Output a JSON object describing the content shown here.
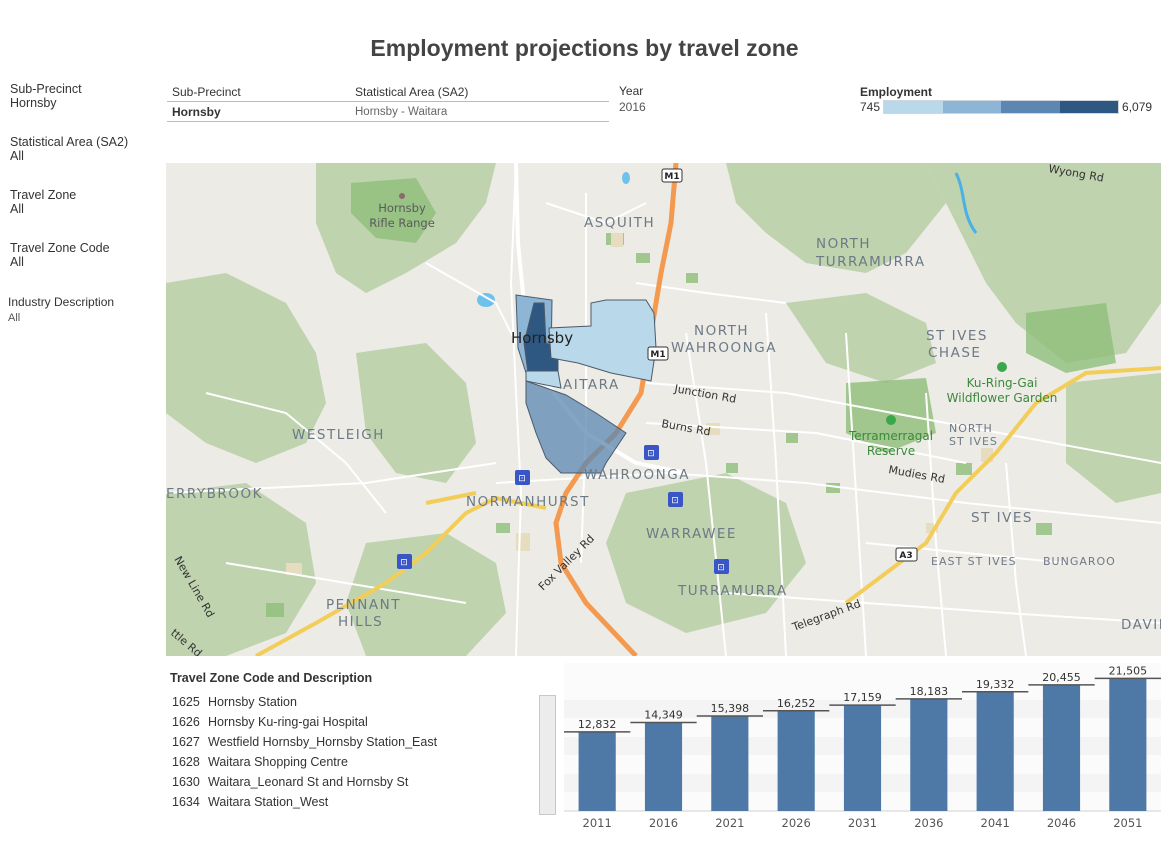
{
  "title": "Employment projections by travel zone",
  "filters": [
    {
      "label": "Sub-Precinct",
      "value": "Hornsby"
    },
    {
      "label": "Statistical Area (SA2)",
      "value": "All"
    },
    {
      "label": "Travel Zone",
      "value": "All"
    },
    {
      "label": "Travel Zone Code",
      "value": "All"
    },
    {
      "label": "Industry Description",
      "value": "All"
    }
  ],
  "info_table": {
    "headers": [
      "Sub-Precinct",
      "Statistical Area (SA2)"
    ],
    "row": [
      "Hornsby",
      "Hornsby - Waitara"
    ]
  },
  "year": {
    "label": "Year",
    "value": "2016"
  },
  "legend": {
    "title": "Employment",
    "min": "745",
    "max": "6,079",
    "colors": [
      "#b9d8ea",
      "#8db5d6",
      "#5c87b2",
      "#2e5882"
    ]
  },
  "map": {
    "places": [
      {
        "name": "ASQUITH"
      },
      {
        "name": "NORTH TURRAMURRA"
      },
      {
        "name": "NORTH WAHROONGA"
      },
      {
        "name": "ST IVES CHASE"
      },
      {
        "name": "WESTLEIGH"
      },
      {
        "name": "NORMANHURST"
      },
      {
        "name": "WAHROONGA"
      },
      {
        "name": "WARRAWEE"
      },
      {
        "name": "TURRAMURRA"
      },
      {
        "name": "PENNANT HILLS"
      },
      {
        "name": "ST IVES"
      },
      {
        "name": "NORTH ST IVES"
      },
      {
        "name": "EAST ST IVES"
      },
      {
        "name": "BUNGAROO"
      },
      {
        "name": "DAVIDSO"
      },
      {
        "name": "ERRYBROOK"
      },
      {
        "name": "Hornsby"
      },
      {
        "name": "AITARA"
      }
    ],
    "roads": [
      "Wyong Rd",
      "Junction Rd",
      "Burns Rd",
      "Mudies Rd",
      "Fox Valley Rd",
      "Telegraph Rd",
      "New Line Rd",
      "ttle Rd"
    ],
    "parks": [
      "Hornsby Rifle Range",
      "Ku-Ring-Gai Wildflower Garden",
      "Terramerragal Reserve"
    ],
    "shields": [
      "M1",
      "M1",
      "A3"
    ],
    "zone_colors": [
      "#b9d8ea",
      "#5c87b2",
      "#2e5882",
      "#8db5d6"
    ]
  },
  "travel_zones": {
    "title": "Travel Zone Code and Description",
    "items": [
      {
        "code": "1625",
        "desc": "Hornsby Station"
      },
      {
        "code": "1626",
        "desc": "Hornsby Ku-ring-gai Hospital"
      },
      {
        "code": "1627",
        "desc": "Westfield Hornsby_Hornsby Station_East"
      },
      {
        "code": "1628",
        "desc": "Waitara Shopping Centre"
      },
      {
        "code": "1630",
        "desc": "Waitara_Leonard St and Hornsby St"
      },
      {
        "code": "1634",
        "desc": "Waitara Station_West"
      }
    ]
  },
  "chart_data": {
    "type": "bar",
    "categories": [
      "2011",
      "2016",
      "2021",
      "2026",
      "2031",
      "2036",
      "2041",
      "2046",
      "2051"
    ],
    "values": [
      12832,
      14349,
      15398,
      16252,
      17159,
      18183,
      19332,
      20455,
      21505
    ],
    "labels": [
      "12,832",
      "14,349",
      "15,398",
      "16,252",
      "17,159",
      "18,183",
      "19,332",
      "20,455",
      "21,505"
    ],
    "ylim": [
      0,
      24000
    ],
    "bar_color": "#4e79a7",
    "grid": false
  }
}
